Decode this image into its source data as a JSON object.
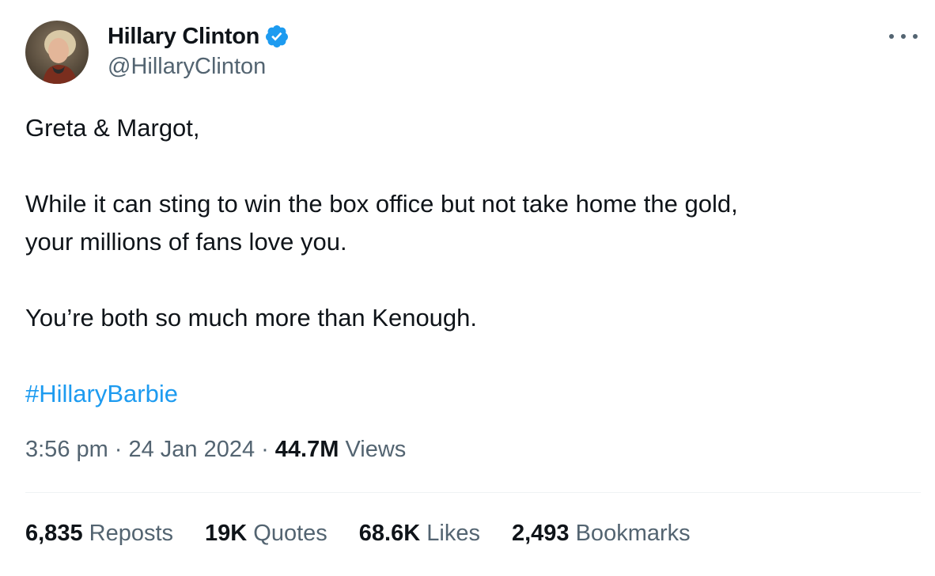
{
  "author": {
    "display_name": "Hillary Clinton",
    "handle": "@HillaryClinton",
    "verified_color": "#1d9bf0"
  },
  "tweet": {
    "lines": [
      "Greta & Margot,",
      "While it can sting to win the box office but not take home the gold,",
      "your millions of fans love you.",
      "You’re both so much more than Kenough."
    ],
    "hashtag": "#HillaryBarbie"
  },
  "meta": {
    "time": "3:56 pm",
    "date": "24 Jan 2024",
    "separator": "·",
    "views_count": "44.7M",
    "views_label": "Views"
  },
  "stats": {
    "reposts": {
      "count": "6,835",
      "label": "Reposts"
    },
    "quotes": {
      "count": "19K",
      "label": "Quotes"
    },
    "likes": {
      "count": "68.6K",
      "label": "Likes"
    },
    "bookmarks": {
      "count": "2,493",
      "label": "Bookmarks"
    }
  },
  "colors": {
    "text_primary": "#0f1419",
    "text_secondary": "#536471",
    "link": "#1d9bf0",
    "divider": "#eff3f4"
  },
  "icons": {
    "verified": "verified-badge-icon",
    "more": "more-options-icon"
  }
}
